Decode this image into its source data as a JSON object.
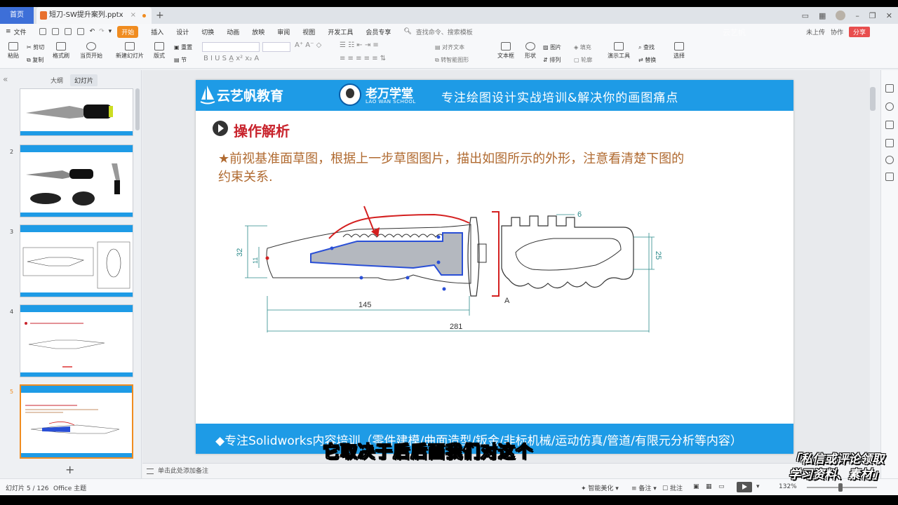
{
  "titlebar": {
    "home_tab": "首页",
    "doc_tab": "短刀-SW提升案列.pptx"
  },
  "menu": {
    "file": "文件",
    "tabs": [
      "开始",
      "插入",
      "设计",
      "切换",
      "动画",
      "放映",
      "审阅",
      "视图",
      "开发工具",
      "会员专享"
    ],
    "search": "查找命令、搜索模板",
    "right": [
      "未上传",
      "协作",
      "分享"
    ]
  },
  "ribbon": {
    "paste": "粘贴",
    "cut": "剪切",
    "copy": "复制",
    "format_painter": "格式刷",
    "start_from_current": "当页开始",
    "new_slide": "新建幻灯片",
    "layout": "版式",
    "section": "节",
    "reset": "重置",
    "align_text": "对齐文本",
    "smart_graphic": "转智能图形",
    "textbox": "文本框",
    "shape": "形状",
    "arrange": "排列",
    "picture": "图片",
    "fill": "填充",
    "outline": "轮廓",
    "presentation_tools": "演示工具",
    "find": "查找",
    "replace": "替换",
    "select": "选择"
  },
  "left_panel": {
    "tab_outline": "大纲",
    "tab_slides": "幻灯片",
    "slide_numbers": [
      "2",
      "3",
      "4",
      "5"
    ],
    "selected_slide": 5
  },
  "slide": {
    "brand1": "云艺帆教育",
    "brand2": "老万学堂",
    "brand2_sub": "LAO WAN SCHOOL",
    "slogan": "专注绘图设计实战培训&解决你的画图痛点",
    "section_title": "操作解析",
    "instruction": "★前视基准面草图，根据上一步草图图片，描出如图所示的外形，注意看清楚下图的约束关系.",
    "footer": "◆专注Solidworks内容培训（零件建模/曲面造型/钣金/非标机械/运动仿真/管道/有限元分析等内容）",
    "dims": {
      "d145": "145",
      "d281": "281",
      "d6": "6",
      "d32": "32",
      "d11": "11",
      "d25": "25",
      "sectionA": "A"
    }
  },
  "notes": {
    "placeholder": "单击此处添加备注"
  },
  "status": {
    "slide_info": "幻灯片 5 / 126",
    "theme": "Office 主题",
    "smart_beautify": "智能美化",
    "notes_btn": "备注",
    "comments_btn": "批注",
    "zoom": "132%"
  },
  "overlay": {
    "subtitle": "它取决于后后面我们对这个",
    "promo_line1": "「私信或评论领取",
    "promo_line2": "学习资料、素材」"
  },
  "colors": {
    "accent_orange": "#f08c20",
    "slide_blue": "#1e9be6",
    "title_red": "#c8232c",
    "instruction_brown": "#b06a30",
    "sketch_blue": "#2a4fd6",
    "sketch_red": "#d42020"
  }
}
